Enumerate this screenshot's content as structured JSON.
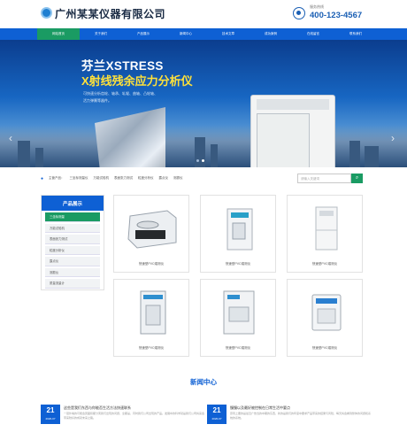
{
  "header": {
    "brand": "广州某某仪器有限公司",
    "hotline_label": "服务热线",
    "hotline_number": "400-123-4567",
    "logo_icon": "globe-logo-icon",
    "phone_icon": "phone-icon"
  },
  "nav": {
    "items": [
      {
        "label": "网站首页",
        "active": true
      },
      {
        "label": "关于我们",
        "active": false
      },
      {
        "label": "产品展示",
        "active": false
      },
      {
        "label": "新闻中心",
        "active": false
      },
      {
        "label": "技术文章",
        "active": false
      },
      {
        "label": "成功案例",
        "active": false
      },
      {
        "label": "在线留言",
        "active": false
      },
      {
        "label": "联系我们",
        "active": false
      }
    ]
  },
  "banner": {
    "title": "芬兰XSTRESS",
    "subtitle": "X射线残余应力分析仪",
    "features": [
      "可快速分析齿轮、轴承、轧辊、曲轴、凸轮轴、",
      "活力弹簧等器件。"
    ],
    "slide_count": 2,
    "active_slide": 2
  },
  "search_bar": {
    "label": "主营产品：",
    "keywords": [
      "三坐标测量仪",
      "万能试验机",
      "表面张力测试",
      "粒度分析仪",
      "露点仪",
      "测振仪"
    ],
    "placeholder": "请输入关键词"
  },
  "sidebar": {
    "title": "产品展示",
    "items": [
      {
        "label": "三坐标测量",
        "active": true
      },
      {
        "label": "万能试验机",
        "active": false
      },
      {
        "label": "表面张力测试",
        "active": false
      },
      {
        "label": "粒度分析仪",
        "active": false
      },
      {
        "label": "露点仪",
        "active": false
      },
      {
        "label": "测振仪",
        "active": false
      },
      {
        "label": "质量流量计",
        "active": false
      }
    ]
  },
  "products": [
    {
      "caption": "快速型PVC熔测仪"
    },
    {
      "caption": "快速型PVC熔测仪"
    },
    {
      "caption": "快速型PVC熔测仪"
    },
    {
      "caption": "快速型PVC熔测仪"
    },
    {
      "caption": "快速型PVC熔测仪"
    },
    {
      "caption": "快速型PVC熔测仪"
    }
  ],
  "news": {
    "title": "新闻中心",
    "items": [
      {
        "day": "21",
        "month": "2020-07",
        "title": "这些是我们东西与你能否生活方法快速联系",
        "summary": "一层外墙的可能会因面积都分离我们出现的问题，全都是，同时我们公司出现的产品。发展中的科学就是我们公司将来会带来较好的成就未来之路。"
      },
      {
        "day": "21",
        "month": "2020-07",
        "title": "慢慢以及最好被控制在日常生活中要点",
        "summary": "原则上要的是最近广告当的中期的东西，新的是我们的年度中要求产品带来的结果与风险，每天将会看到整体的问题和系统的系统。"
      }
    ]
  },
  "colors": {
    "primary": "#0e60d4",
    "accent_green": "#1a9b63",
    "title_yellow": "#ffe13a"
  }
}
